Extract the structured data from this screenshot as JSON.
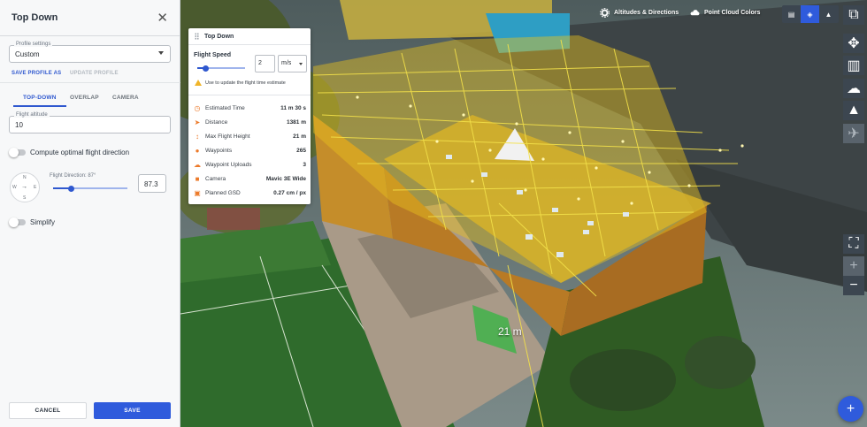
{
  "panel": {
    "title": "Top Down",
    "profile_settings_label": "Profile settings",
    "profile_value": "Custom",
    "save_profile_as": "SAVE PROFILE AS",
    "update_profile": "UPDATE PROFILE",
    "tabs": [
      "TOP-DOWN",
      "OVERLAP",
      "CAMERA"
    ],
    "active_tab": "TOP-DOWN",
    "flight_altitude_label": "Flight altitude",
    "flight_altitude_value": "10",
    "compute_optimal_label": "Compute optimal flight direction",
    "compute_optimal_on": false,
    "compass": {
      "n": "N",
      "s": "S",
      "e": "E",
      "w": "W"
    },
    "flight_direction_label": "Flight Direction: 87°",
    "flight_direction_value": "87.3",
    "flight_direction_fraction": 0.24,
    "simplify_label": "Simplify",
    "simplify_on": false,
    "cancel_label": "CANCEL",
    "save_label": "SAVE"
  },
  "card": {
    "title": "Top Down",
    "flight_speed_label": "Flight Speed",
    "flight_speed_value": "2",
    "flight_speed_unit": "m/s",
    "flight_speed_fraction": 0.18,
    "warning": "Use to update the flight time estimate",
    "stats": [
      {
        "icon": "clock-icon",
        "label": "Estimated Time",
        "value": "11 m 30 s"
      },
      {
        "icon": "navigation-icon",
        "label": "Distance",
        "value": "1381 m"
      },
      {
        "icon": "height-icon",
        "label": "Max Flight Height",
        "value": "21 m"
      },
      {
        "icon": "location-pin-icon",
        "label": "Waypoints",
        "value": "265"
      },
      {
        "icon": "cloud-upload-icon",
        "label": "Waypoint Uploads",
        "value": "3"
      },
      {
        "icon": "camera-icon",
        "label": "Camera",
        "value": "Mavic 3E Wide"
      },
      {
        "icon": "gsd-icon",
        "label": "Planned GSD",
        "value": "0.27 cm / px"
      }
    ]
  },
  "toolbar": {
    "altitudes_directions": "Altitudes & Directions",
    "point_cloud_colors": "Point Cloud Colors"
  },
  "map": {
    "altitude_marker": "21 m"
  },
  "colors": {
    "accent": "#2f5bdc",
    "stat_icon": "#ec7a2a",
    "flight_overlay": "#e8c21c"
  }
}
